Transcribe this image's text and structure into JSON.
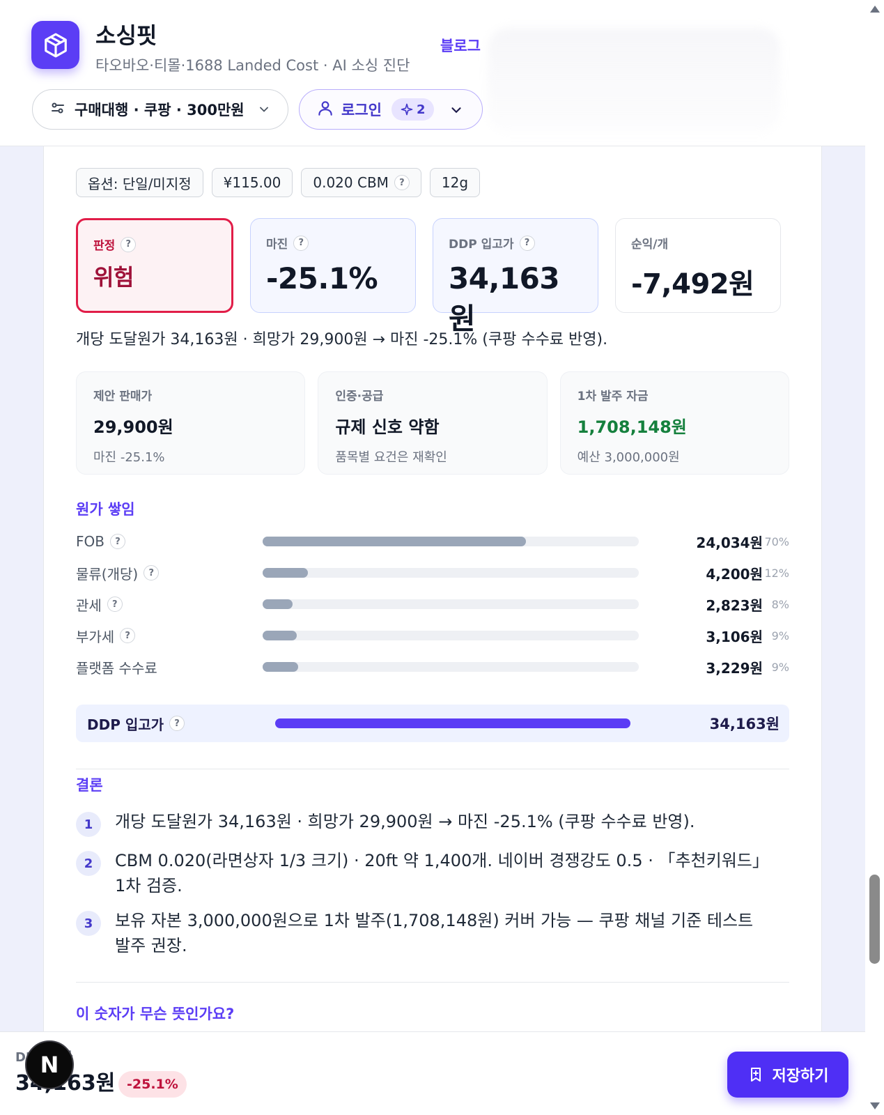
{
  "header": {
    "brand_name": "소싱핏",
    "brand_sub": "타오바오·티몰·1688 Landed Cost · AI 소싱 진단",
    "blog_link": "블로그",
    "preset_pill": "구매대행 · 쿠팡 · 300만원",
    "login_label": "로그인",
    "credit_count": "2"
  },
  "chips": {
    "option": "옵션: 단일/미지정",
    "price": "¥115.00",
    "cbm": "0.020 CBM",
    "weight": "12g"
  },
  "metrics": {
    "verdict_label": "판정",
    "verdict_value": "위험",
    "margin_label": "마진",
    "margin_value": "-25.1%",
    "ddp_label": "DDP 입고가",
    "ddp_value": "34,163원",
    "profit_label": "순익/개",
    "profit_value": "-7,492원"
  },
  "summary_line": "개당 도달원가 34,163원 · 희망가 29,900원 → 마진 -25.1% (쿠팡 수수료 반영).",
  "info": {
    "price_label": "제안 판매가",
    "price_value": "29,900원",
    "price_sub": "마진 -25.1%",
    "cert_label": "인증·공급",
    "cert_value": "규제 신호 약함",
    "cert_sub": "품목별 요건은 재확인",
    "fund_label": "1차 발주 자금",
    "fund_value": "1,708,148원",
    "fund_sub": "예산 3,000,000원"
  },
  "cost_stack": {
    "title": "원가 쌓임",
    "rows": [
      {
        "label": "FOB",
        "amount": "24,034원",
        "pct": "70%",
        "share": 0.7
      },
      {
        "label": "물류(개당)",
        "amount": "4,200원",
        "pct": "12%",
        "share": 0.12
      },
      {
        "label": "관세",
        "amount": "2,823원",
        "pct": "8%",
        "share": 0.08
      },
      {
        "label": "부가세",
        "amount": "3,106원",
        "pct": "9%",
        "share": 0.09
      },
      {
        "label": "플랫폼 수수료",
        "amount": "3,229원",
        "pct": "9%",
        "share": 0.095
      }
    ],
    "total_label": "DDP 입고가",
    "total_amount": "34,163원"
  },
  "conclusion": {
    "title": "결론",
    "items": [
      {
        "num": "1",
        "text": "개당 도달원가 34,163원 · 희망가 29,900원 → 마진 -25.1% (쿠팡 수수료 반영)."
      },
      {
        "num": "2",
        "text": "CBM 0.020(라면상자 1/3 크기) · 20ft 약 1,400개. 네이버 경쟁강도 0.5 · 「추천키워드」 1차 검증."
      },
      {
        "num": "3",
        "text": "보유 자본 3,000,000원으로 1차 발주(1,708,148원) 커버 가능 — 쿠팡 채널 기준 테스트 발주 권장."
      }
    ]
  },
  "faq_title": "이 숫자가 무슨 뜻인가요?",
  "bottom_bar": {
    "label": "DDP 원가",
    "value": "34,163원",
    "margin_badge": "-25.1%",
    "save_label": "저장하기",
    "next_badge": "N"
  },
  "colors": {
    "accent": "#5b3df5",
    "danger": "#e11d48",
    "success": "#15803d"
  }
}
